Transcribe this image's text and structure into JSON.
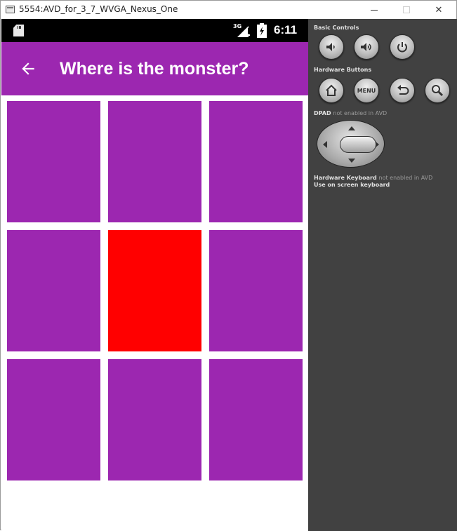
{
  "window": {
    "title": "5554:AVD_for_3_7_WVGA_Nexus_One",
    "minimize_icon": "minimize-icon",
    "maximize_icon": "maximize-icon",
    "close_glyph": "✕"
  },
  "statusbar": {
    "network": "3G",
    "time": "6:11",
    "icons": [
      "sd-card-icon",
      "signal-icon",
      "battery-icon"
    ]
  },
  "appbar": {
    "title": "Where is the monster?",
    "back_icon": "arrow-back-icon",
    "color": "#9c27b0"
  },
  "grid": {
    "rows": 3,
    "cols": 3,
    "cells": [
      "empty",
      "empty",
      "empty",
      "empty",
      "monster",
      "empty",
      "empty",
      "empty",
      "empty"
    ],
    "cell_color": "#9c27b0",
    "monster_color": "#ff0000"
  },
  "panel": {
    "basic_controls_label": "Basic Controls",
    "hardware_buttons_label": "Hardware Buttons",
    "dpad_label": "DPAD",
    "dpad_note": "not enabled in AVD",
    "keyboard_label": "Hardware Keyboard",
    "keyboard_note": "not enabled in AVD",
    "keyboard_hint": "Use on screen keyboard",
    "menu_label": "MENU",
    "basic_buttons": [
      "volume-down-icon",
      "volume-up-icon",
      "power-icon"
    ],
    "hardware_buttons": [
      "home-icon",
      "menu-button",
      "back-icon",
      "search-icon"
    ]
  }
}
